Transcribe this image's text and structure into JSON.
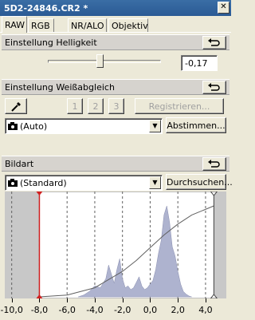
{
  "window": {
    "title": "5D2-24846.CR2 *",
    "close_glyph": "✕"
  },
  "tabs": [
    {
      "label": "RAW",
      "active": true
    },
    {
      "label": "RGB"
    },
    {
      "label": "NR/ALO"
    },
    {
      "label": "Objektiv"
    }
  ],
  "brightness": {
    "section_title": "Einstellung Helligkeit",
    "reset_icon": "reset-arrow-icon",
    "value": "-0,17",
    "slider_fraction": 0.46
  },
  "white_balance": {
    "section_title": "Einstellung Weißabgleich",
    "reset_icon": "reset-arrow-icon",
    "eyedropper_icon": "eyedropper-icon",
    "slots": [
      "1",
      "2",
      "3"
    ],
    "register_label": "Registrieren...",
    "preset_icon": "camera-icon",
    "preset_value": "(Auto)",
    "finetune_label": "Abstimmen..."
  },
  "picture_style": {
    "section_title": "Bildart",
    "reset_icon": "reset-arrow-icon",
    "preset_icon": "camera-icon",
    "preset_value": "(Standard)",
    "browse_label": "Durchsuchen..."
  },
  "chart_data": {
    "type": "area",
    "title": "",
    "xlabel": "",
    "ylabel": "",
    "xlim": [
      -10.5,
      5.5
    ],
    "ticks": [
      "-10,0",
      "-8,0",
      "-6,0",
      "-4,0",
      "-2,0",
      "0,0",
      "2,0",
      "4,0"
    ],
    "tick_values": [
      -10,
      -8,
      -6,
      -4,
      -2,
      0,
      2,
      4
    ],
    "black_point": -8.0,
    "white_point": 4.6,
    "histogram": {
      "x": [
        -5.2,
        -4.8,
        -4.4,
        -4.0,
        -3.6,
        -3.2,
        -3.0,
        -2.8,
        -2.6,
        -2.4,
        -2.2,
        -2.0,
        -1.8,
        -1.6,
        -1.4,
        -1.2,
        -1.0,
        -0.8,
        -0.6,
        -0.4,
        -0.2,
        0.0,
        0.2,
        0.4,
        0.6,
        0.8,
        1.0,
        1.2,
        1.4,
        1.6,
        1.8,
        2.0,
        2.2,
        2.4,
        2.6,
        2.8,
        3.0
      ],
      "y": [
        0.0,
        0.02,
        0.06,
        0.12,
        0.1,
        0.2,
        0.35,
        0.25,
        0.15,
        0.3,
        0.42,
        0.2,
        0.1,
        0.12,
        0.08,
        0.1,
        0.16,
        0.22,
        0.12,
        0.08,
        0.1,
        0.14,
        0.18,
        0.3,
        0.48,
        0.62,
        0.9,
        1.0,
        0.82,
        0.55,
        0.45,
        0.28,
        0.14,
        0.06,
        0.03,
        0.01,
        0.0
      ]
    },
    "curve": {
      "x": [
        -8.0,
        -6.0,
        -4.0,
        -2.0,
        -1.0,
        0.0,
        1.0,
        2.0,
        3.0,
        4.6
      ],
      "y": [
        0.0,
        0.02,
        0.1,
        0.28,
        0.4,
        0.54,
        0.68,
        0.8,
        0.9,
        1.0
      ]
    },
    "colors": {
      "fill": "#aeb3cf",
      "plot_bg": "#ffffff",
      "clip_bg": "#c8c8c8",
      "black_marker": "#d02020"
    }
  }
}
